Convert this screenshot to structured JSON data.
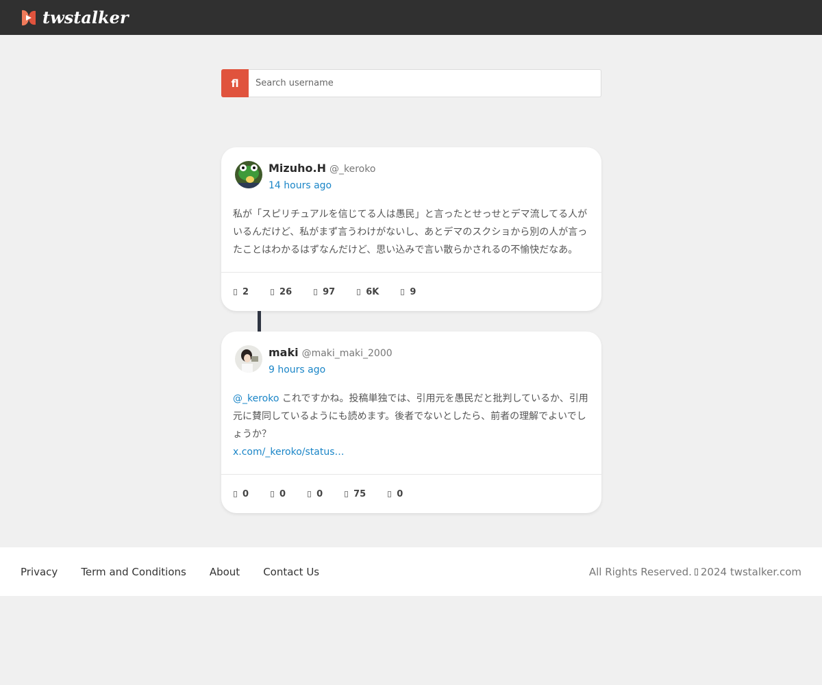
{
  "header": {
    "brand": "twstalker"
  },
  "search": {
    "button_glyph": "fl",
    "placeholder": "Search username"
  },
  "tweets": [
    {
      "display_name": "Mizuho.H",
      "handle": "@_keroko",
      "time": "14 hours ago",
      "text": "私が「スピリチュアルを信じてる人は愚民」と言ったとせっせとデマ流してる人がいるんだけど、私がまず言うわけがないし、あとデマのスクショから別の人が言ったことはわかるはずなんだけど、思い込みで言い散らかされるの不愉快だなあ。",
      "stats": {
        "replies": "2",
        "retweets": "26",
        "likes": "97",
        "views": "6K",
        "bookmarks": "9"
      }
    },
    {
      "display_name": "maki",
      "handle": "@maki_maki_2000",
      "time": "9 hours ago",
      "mention": "@_keroko",
      "text": " これですかね。投稿単独では、引用元を愚民だと批判しているか、引用元に賛同しているようにも読めます。後者でないとしたら、前者の理解でよいでしょうか？",
      "link": "x.com/_keroko/status…",
      "stats": {
        "replies": "0",
        "retweets": "0",
        "likes": "0",
        "views": "75",
        "bookmarks": "0"
      }
    }
  ],
  "footer": {
    "links": [
      "Privacy",
      "Term and Conditions",
      "About",
      "Contact Us"
    ],
    "rights": "All Rights Reserved.",
    "copyright_year_site": "2024 twstalker.com"
  },
  "colors": {
    "accent": "#e0533d",
    "link": "#1a85c7",
    "topbar": "#303030"
  }
}
